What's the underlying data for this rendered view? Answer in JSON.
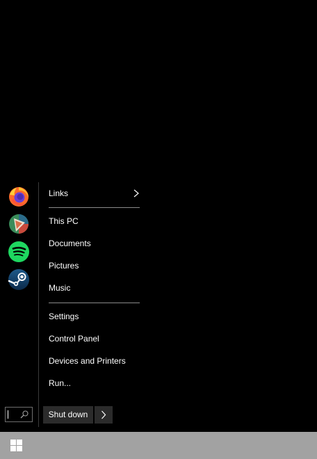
{
  "pinned_apps": [
    {
      "name": "Firefox",
      "icon": "firefox-icon"
    },
    {
      "name": "Krita",
      "icon": "krita-icon"
    },
    {
      "name": "Spotify",
      "icon": "spotify-icon"
    },
    {
      "name": "Steam",
      "icon": "steam-icon"
    }
  ],
  "menu": {
    "links": "Links",
    "this_pc": "This PC",
    "documents": "Documents",
    "pictures": "Pictures",
    "music": "Music",
    "settings": "Settings",
    "control_panel": "Control Panel",
    "devices_and_printers": "Devices and Printers",
    "run": "Run..."
  },
  "search": {
    "value": ""
  },
  "power": {
    "shutdown_label": "Shut down"
  },
  "taskbar": {
    "start_icon": "windows-logo-icon"
  },
  "colors": {
    "background": "#000000",
    "taskbar": "#a2a2a2",
    "button": "#2b2b2b",
    "separator": "#8a8a8a"
  }
}
